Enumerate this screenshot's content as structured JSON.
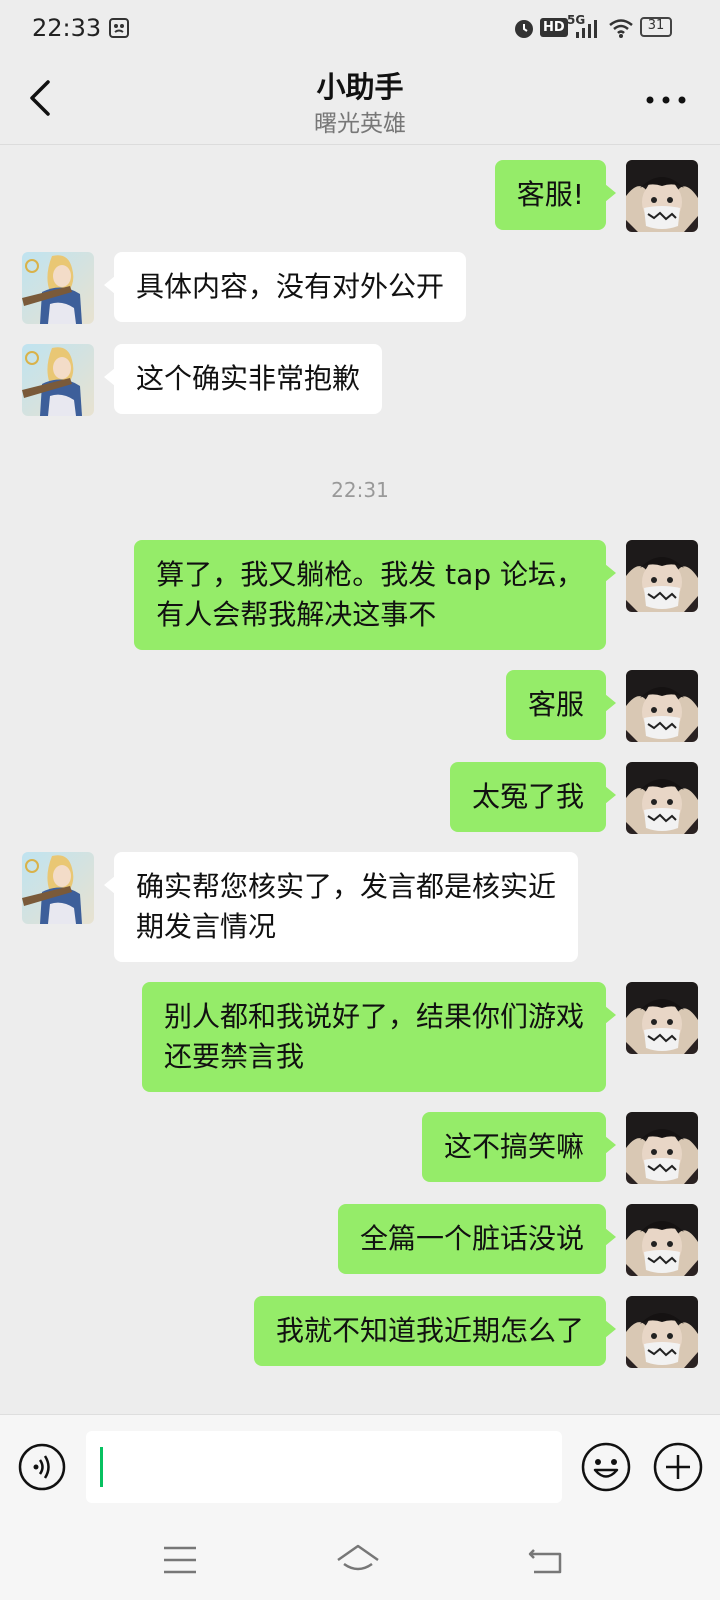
{
  "status_bar": {
    "time": "22:33",
    "network": "5G",
    "hd": "HD",
    "battery": "31"
  },
  "header": {
    "title": "小助手",
    "subtitle": "曙光英雄"
  },
  "messages": [
    {
      "sender": "me",
      "text": "客服!"
    },
    {
      "sender": "them",
      "text": "具体内容，没有对外公开"
    },
    {
      "sender": "them",
      "text": "这个确实非常抱歉"
    },
    {
      "sender": "me",
      "text": "算了，我又躺枪。我发 tap 论坛，\n有人会帮我解决这事不"
    },
    {
      "sender": "me",
      "text": "客服"
    },
    {
      "sender": "me",
      "text": "太冤了我"
    },
    {
      "sender": "them",
      "text": "确实帮您核实了，发言都是核实近\n期发言情况"
    },
    {
      "sender": "me",
      "text": "别人都和我说好了，结果你们游戏\n还要禁言我"
    },
    {
      "sender": "me",
      "text": "这不搞笑嘛"
    },
    {
      "sender": "me",
      "text": "全篇一个脏话没说"
    },
    {
      "sender": "me",
      "text": "我就不知道我近期怎么了"
    }
  ],
  "timestamp": "22:31",
  "input": {
    "value": ""
  },
  "icons": {
    "back": "chevron-left-icon",
    "more": "more-dots-icon",
    "voice": "voice-icon",
    "emoji": "emoji-icon",
    "plus": "plus-icon"
  },
  "colors": {
    "sent_bubble": "#95ec69",
    "received_bubble": "#ffffff",
    "background": "#ededed",
    "caret": "#07c160"
  }
}
